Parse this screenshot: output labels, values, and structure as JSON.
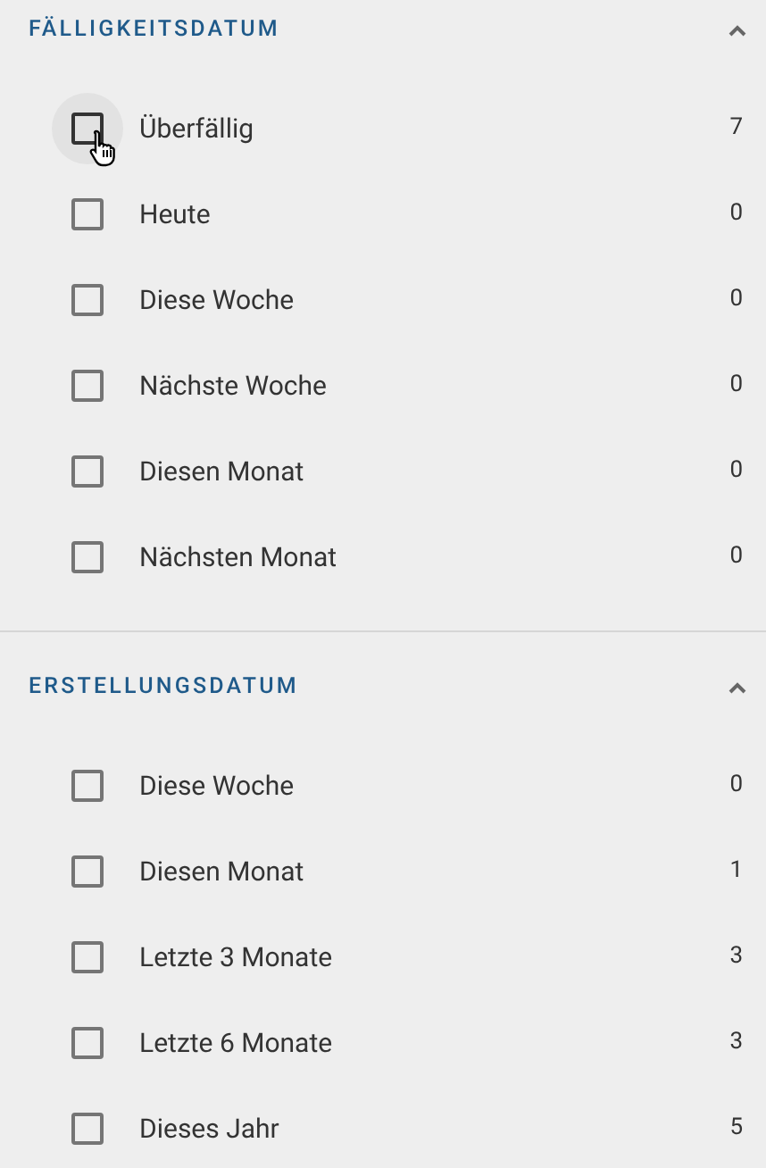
{
  "sections": [
    {
      "title": "FÄLLIGKEITSDATUM",
      "expanded": true,
      "items": [
        {
          "label": "Überfällig",
          "count": "7",
          "checked": false,
          "hovered": true
        },
        {
          "label": "Heute",
          "count": "0",
          "checked": false,
          "hovered": false
        },
        {
          "label": "Diese Woche",
          "count": "0",
          "checked": false,
          "hovered": false
        },
        {
          "label": "Nächste Woche",
          "count": "0",
          "checked": false,
          "hovered": false
        },
        {
          "label": "Diesen Monat",
          "count": "0",
          "checked": false,
          "hovered": false
        },
        {
          "label": "Nächsten Monat",
          "count": "0",
          "checked": false,
          "hovered": false
        }
      ]
    },
    {
      "title": "ERSTELLUNGSDATUM",
      "expanded": true,
      "items": [
        {
          "label": "Diese Woche",
          "count": "0",
          "checked": false,
          "hovered": false
        },
        {
          "label": "Diesen Monat",
          "count": "1",
          "checked": false,
          "hovered": false
        },
        {
          "label": "Letzte 3 Monate",
          "count": "3",
          "checked": false,
          "hovered": false
        },
        {
          "label": "Letzte 6 Monate",
          "count": "3",
          "checked": false,
          "hovered": false
        },
        {
          "label": "Dieses Jahr",
          "count": "5",
          "checked": false,
          "hovered": false
        }
      ]
    }
  ]
}
